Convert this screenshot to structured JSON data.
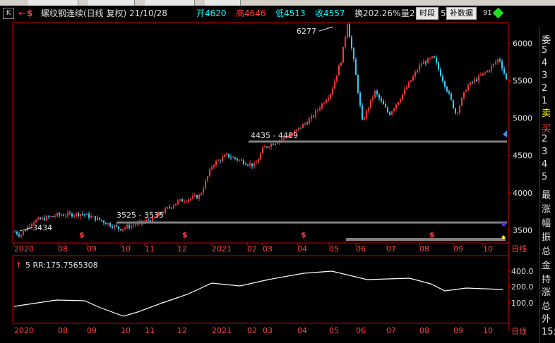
{
  "header": {
    "k_icon": "K",
    "arrow_glyph": "←",
    "dollar_glyph": "$",
    "title": "螺纹钢连续(日线 复权) 21/10/28",
    "open_label": "开4620",
    "high_label": "高4646",
    "low_label": "低4513",
    "close_label": "收4557",
    "turnover_label": "换202.26%",
    "volume_label": "量2",
    "extra_digit": "5",
    "extra_tail": "91",
    "btn_timeline": "时段",
    "btn_fill": "补数据"
  },
  "main_chart": {
    "price_labels": [
      "6000",
      "5500",
      "5000",
      "4500",
      "4000",
      "3500"
    ],
    "annotations": {
      "high_marker": "6277",
      "low_marker": "3434",
      "zone_upper": "4435 - 4489",
      "zone_lower": "3525 - 3535"
    },
    "event_marker": "$",
    "months": [
      "2020",
      "08",
      "09",
      "10",
      "11",
      "12",
      "2021",
      "02",
      "03",
      "04",
      "05",
      "06",
      "07",
      "08",
      "09",
      "10"
    ],
    "period_label": "日线"
  },
  "indicator": {
    "arrow": "↑",
    "legend": "5 RR:175.7565308",
    "y_labels": [
      "400.0",
      "200.0",
      "100.0"
    ],
    "months": [
      "2020",
      "08",
      "09",
      "10",
      "11",
      "12",
      "2021",
      "02",
      "03",
      "04",
      "05",
      "06",
      "07",
      "08",
      "09",
      "10"
    ],
    "period_label": "日线"
  },
  "right_panel": {
    "items": [
      "委",
      "5",
      "4",
      "3",
      "2",
      "1",
      "卖",
      "买",
      "2",
      "3",
      "4",
      "5",
      "最",
      "涨",
      "幅",
      "振",
      "总",
      "金",
      "持",
      "涨",
      "总",
      "外",
      "15:"
    ]
  },
  "colors": {
    "up": "#ff3333",
    "down": "#33ccff",
    "grid": "#8b0000",
    "axis": "#cc0000",
    "support_line": "#808080",
    "indicator_line": "#ffffff",
    "cyan_text": "#00ffff",
    "red_text": "#ff4040",
    "yellow_text": "#ffff00"
  }
}
